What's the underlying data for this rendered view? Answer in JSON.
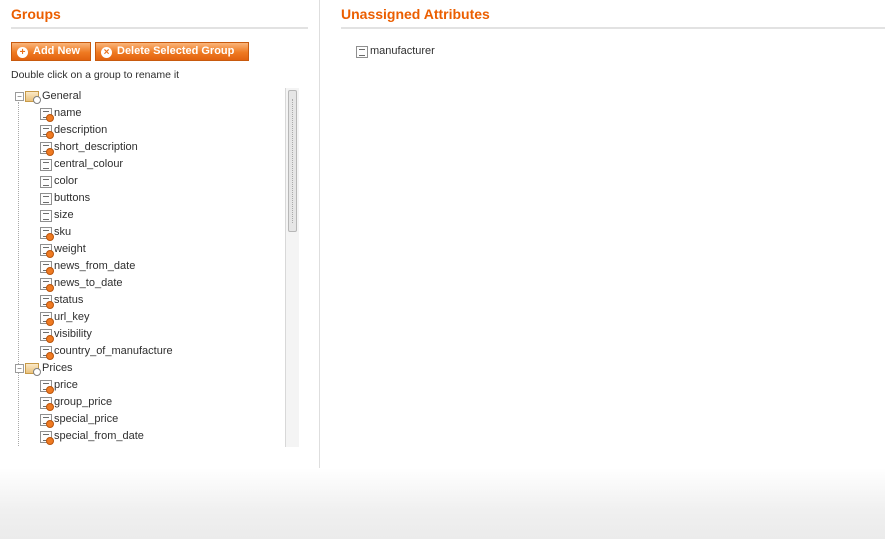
{
  "groups": {
    "title": "Groups",
    "add_label": "Add New",
    "delete_label": "Delete Selected Group",
    "hint": "Double click on a group to rename it",
    "tree": [
      {
        "label": "General",
        "items": [
          {
            "label": "name",
            "system": true
          },
          {
            "label": "description",
            "system": true
          },
          {
            "label": "short_description",
            "system": true
          },
          {
            "label": "central_colour",
            "system": false
          },
          {
            "label": "color",
            "system": false
          },
          {
            "label": "buttons",
            "system": false
          },
          {
            "label": "size",
            "system": false
          },
          {
            "label": "sku",
            "system": true
          },
          {
            "label": "weight",
            "system": true
          },
          {
            "label": "news_from_date",
            "system": true
          },
          {
            "label": "news_to_date",
            "system": true
          },
          {
            "label": "status",
            "system": true
          },
          {
            "label": "url_key",
            "system": true
          },
          {
            "label": "visibility",
            "system": true
          },
          {
            "label": "country_of_manufacture",
            "system": true
          }
        ]
      },
      {
        "label": "Prices",
        "items": [
          {
            "label": "price",
            "system": true
          },
          {
            "label": "group_price",
            "system": true
          },
          {
            "label": "special_price",
            "system": true
          },
          {
            "label": "special_from_date",
            "system": true
          }
        ]
      }
    ]
  },
  "unassigned": {
    "title": "Unassigned Attributes",
    "items": [
      {
        "label": "manufacturer",
        "system": false
      }
    ]
  },
  "colors": {
    "accent": "#eb5e00",
    "button": "#ef7a22"
  }
}
